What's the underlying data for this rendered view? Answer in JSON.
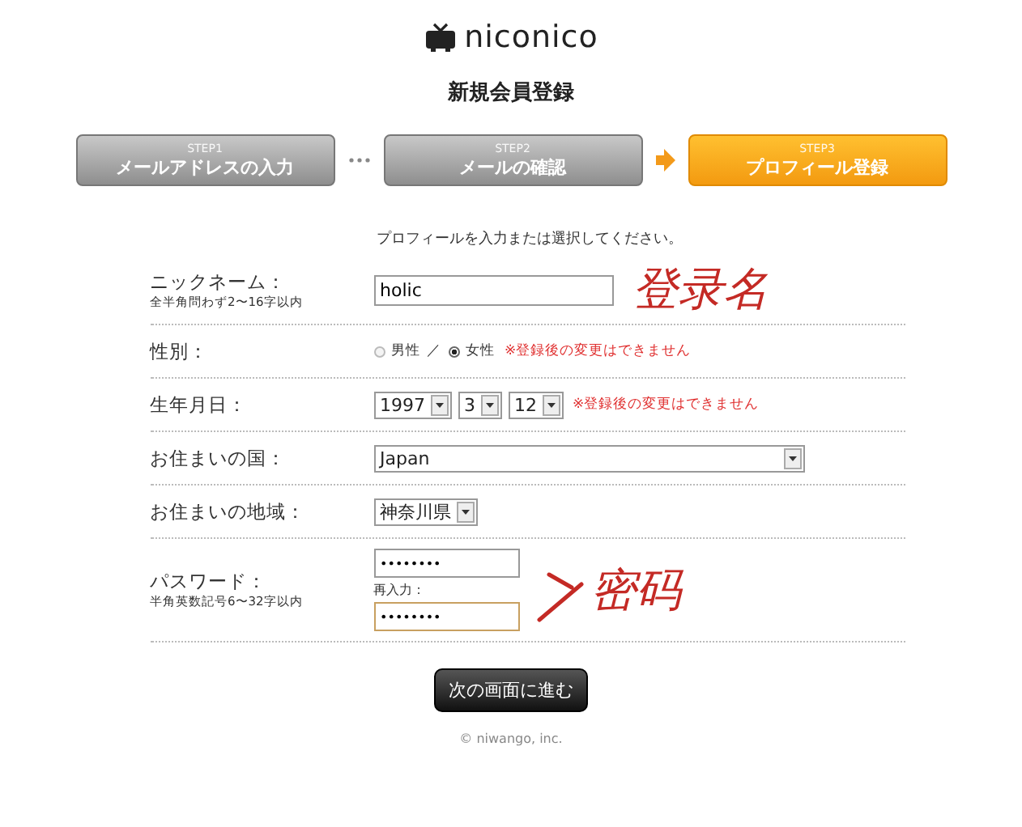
{
  "logo": {
    "text": "niconico"
  },
  "title": "新規会員登録",
  "steps": [
    {
      "step": "STEP1",
      "label": "メールアドレスの入力",
      "selected": false
    },
    {
      "step": "STEP2",
      "label": "メールの確認",
      "selected": false
    },
    {
      "step": "STEP3",
      "label": "プロフィール登録",
      "selected": true
    }
  ],
  "intro": "プロフィールを入力または選択してください。",
  "rows": [
    {
      "kind": "text",
      "label": "ニックネーム：",
      "hint": "全半角問わず2〜16字以内",
      "value": "holic",
      "annotation": "登录名"
    },
    {
      "kind": "radio",
      "label": "性別：",
      "options": [
        {
          "label": "男性",
          "selected": false
        },
        {
          "label": "女性",
          "selected": true
        }
      ],
      "separator": "／",
      "note": "※登録後の変更はできません"
    },
    {
      "kind": "date",
      "label": "生年月日：",
      "selects": [
        "1997",
        "3",
        "12"
      ],
      "note": "※登録後の変更はできません"
    },
    {
      "kind": "select",
      "label": "お住まいの国：",
      "value": "Japan",
      "wide": true
    },
    {
      "kind": "select",
      "label": "お住まいの地域：",
      "value": "神奈川県",
      "wide": false
    },
    {
      "kind": "password",
      "label": "パスワード：",
      "hint": "半角英数記号6〜32字以内",
      "value": "••••••••",
      "confirm_label": "再入力：",
      "confirm_value": "••••••••",
      "annotation": "密码"
    }
  ],
  "submit": "次の画面に進む",
  "copyright": "© niwango, inc."
}
